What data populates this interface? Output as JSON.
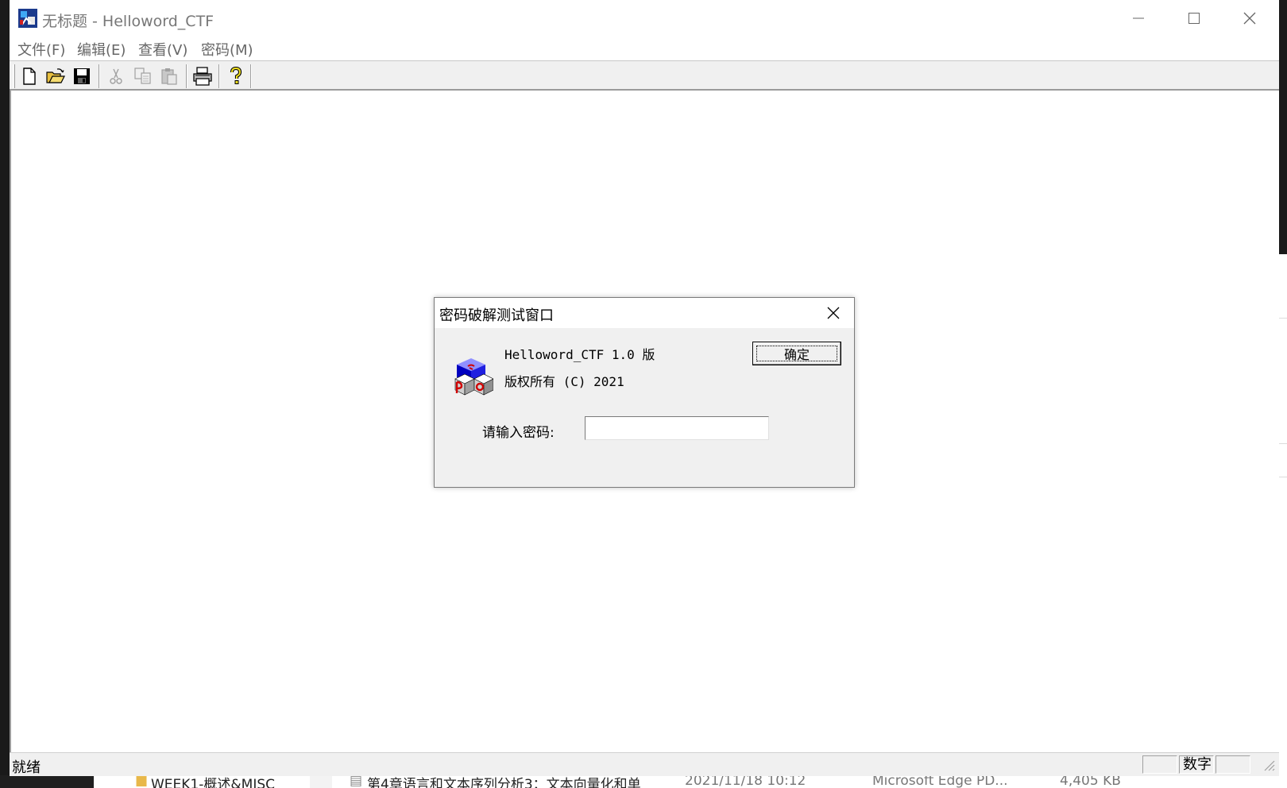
{
  "window": {
    "title": "无标题 - Helloword_CTF",
    "icons": {
      "app": "app-icon",
      "minimize": "minimize-icon",
      "maximize": "maximize-icon",
      "close": "close-icon"
    }
  },
  "menu": [
    {
      "label": "文件(F)"
    },
    {
      "label": "编辑(E)"
    },
    {
      "label": "查看(V)"
    },
    {
      "label": "密码(M)"
    }
  ],
  "toolbar": [
    {
      "icon": "new-file-icon",
      "enabled": true
    },
    {
      "icon": "open-folder-icon",
      "enabled": true
    },
    {
      "icon": "save-icon",
      "enabled": true
    },
    {
      "icon": "cut-icon",
      "enabled": false
    },
    {
      "icon": "copy-icon",
      "enabled": false
    },
    {
      "icon": "paste-icon",
      "enabled": false
    },
    {
      "icon": "print-icon",
      "enabled": true
    },
    {
      "icon": "help-icon",
      "enabled": true
    }
  ],
  "status": {
    "text": "就绪",
    "panes": [
      "",
      "数字",
      ""
    ]
  },
  "dialog": {
    "title": "密码破解测试窗口",
    "line1": "Helloword_CTF 1.0 版",
    "line2": "版权所有 (C) 2021",
    "prompt": "请输入密码:",
    "password_value": "",
    "ok_label": "确定",
    "logo_icon": "cube-logo-icon"
  },
  "background": {
    "folder_label": "WEEK1-概述&MISC",
    "file_name": "第4章语言和文本序列分析3：文本向量化和单",
    "file_date": "2021/11/18 10:12",
    "file_type": "Microsoft Edge PD...",
    "file_size": "4,405 KB"
  }
}
